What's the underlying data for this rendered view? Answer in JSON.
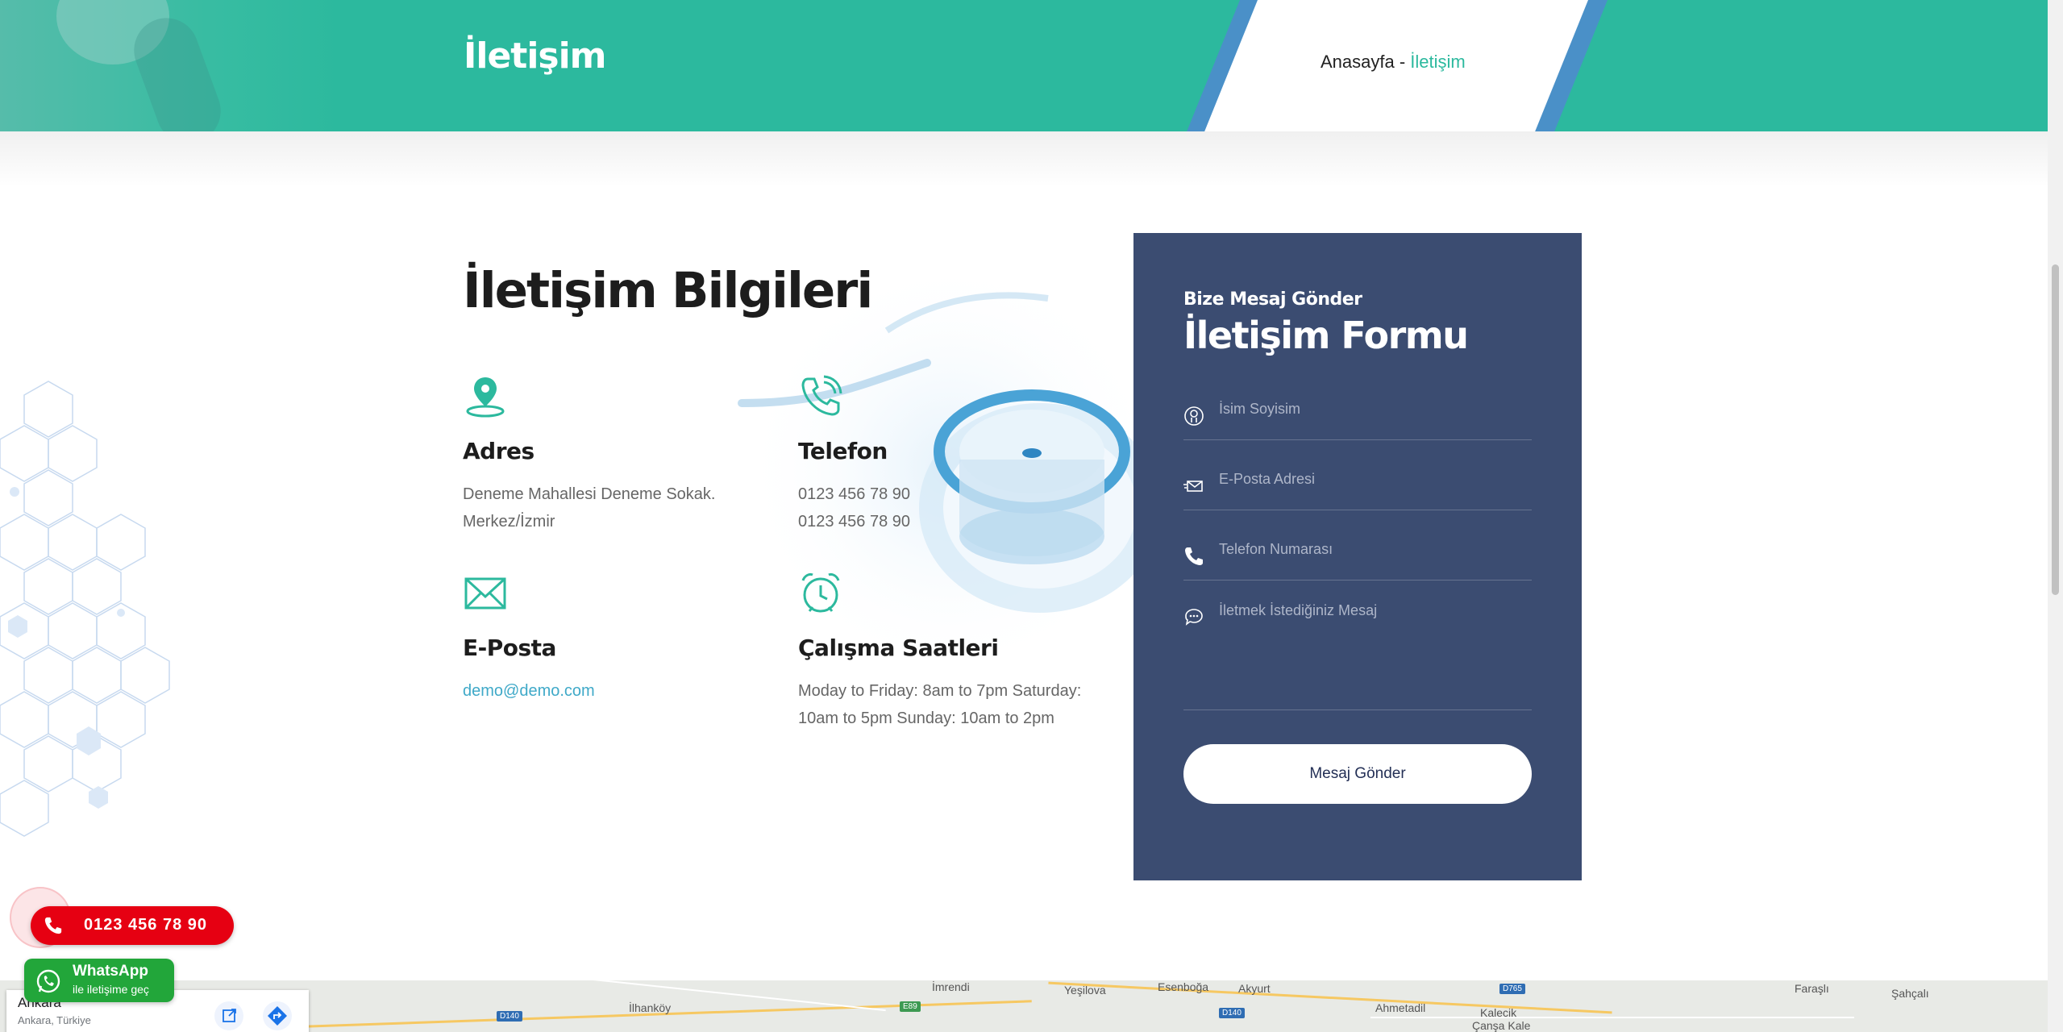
{
  "header": {
    "title": "İletişim",
    "breadcrumb": {
      "home": "Anasayfa",
      "separator": " - ",
      "current": "İletişim"
    }
  },
  "info": {
    "heading": "İletişim Bilgileri",
    "address": {
      "title": "Adres",
      "lines": [
        "Deneme Mahallesi Deneme Sokak.",
        "Merkez/İzmir"
      ]
    },
    "phone": {
      "title": "Telefon",
      "lines": [
        "0123 456 78 90",
        "0123 456 78 90"
      ]
    },
    "email": {
      "title": "E-Posta",
      "value": "demo@demo.com"
    },
    "hours": {
      "title": "Çalışma Saatleri",
      "lines": [
        "Moday to Friday: 8am to 7pm Saturday:",
        "10am to 5pm Sunday: 10am to 2pm"
      ]
    }
  },
  "form": {
    "eyebrow": "Bize Mesaj Gönder",
    "title": "İletişim Formu",
    "name_placeholder": "İsim Soyisim",
    "email_placeholder": "E-Posta Adresi",
    "phone_placeholder": "Telefon Numarası",
    "message_placeholder": "İletmek İstediğiniz Mesaj",
    "submit_label": "Mesaj Gönder"
  },
  "floating": {
    "phone_number": "0123 456 78 90",
    "whatsapp_title": "WhatsApp",
    "whatsapp_sub": "ile iletişime geç"
  },
  "map": {
    "place_title": "Ankara",
    "place_sub": "Ankara, Türkiye",
    "labels": [
      "İmrendi",
      "İlhanköy",
      "Yeşilova",
      "Esenboğa",
      "Akyurt",
      "Ahmetadil",
      "Kalecik",
      "Çanşa Kale",
      "Faraşlı",
      "Şahçalı"
    ],
    "badges": [
      "D140",
      "E89",
      "D140",
      "D765"
    ]
  },
  "colors": {
    "accent": "#2cb99e",
    "form_bg": "#3b4c71",
    "call_red": "#e60012",
    "whatsapp_green": "#22a63a",
    "link": "#3fa9c8"
  }
}
